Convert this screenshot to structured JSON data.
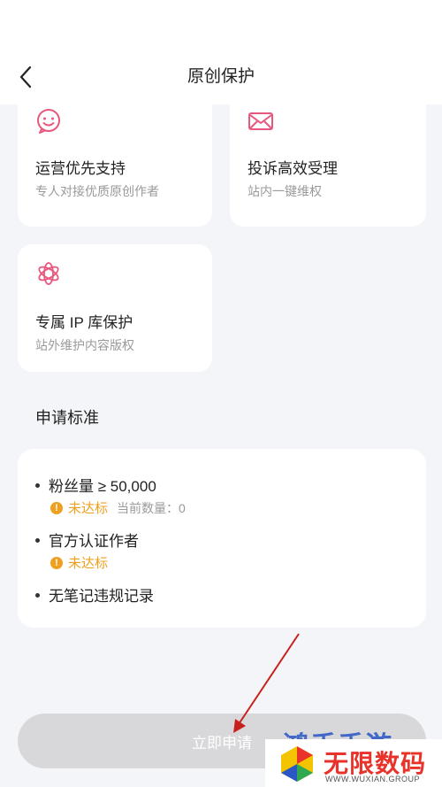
{
  "header": {
    "title": "原创保护"
  },
  "cards": [
    {
      "title": "运营优先支持",
      "subtitle": "专人对接优质原创作者",
      "icon": "smile-chat-icon"
    },
    {
      "title": "投诉高效受理",
      "subtitle": "站内一键维权",
      "icon": "mail-icon"
    },
    {
      "title": "专属 IP 库保护",
      "subtitle": "站外维护内容版权",
      "icon": "flower-icon"
    }
  ],
  "requirements": {
    "title": "申请标准",
    "items": [
      {
        "label": "粉丝量 ≥ 50,000",
        "status": "未达标",
        "count": "当前数量：0"
      },
      {
        "label": "官方认证作者",
        "status": "未达标"
      },
      {
        "label": "无笔记违规记录"
      }
    ]
  },
  "apply_button": {
    "label": "立即申请"
  },
  "watermark": {
    "top": "鸿手手游",
    "brand": "无限数码",
    "sub": "WWW.WUXIAN.GROUP"
  },
  "colors": {
    "accent": "#e8587e",
    "warn": "#f0a020",
    "button_disabled": "#d8d8da"
  }
}
